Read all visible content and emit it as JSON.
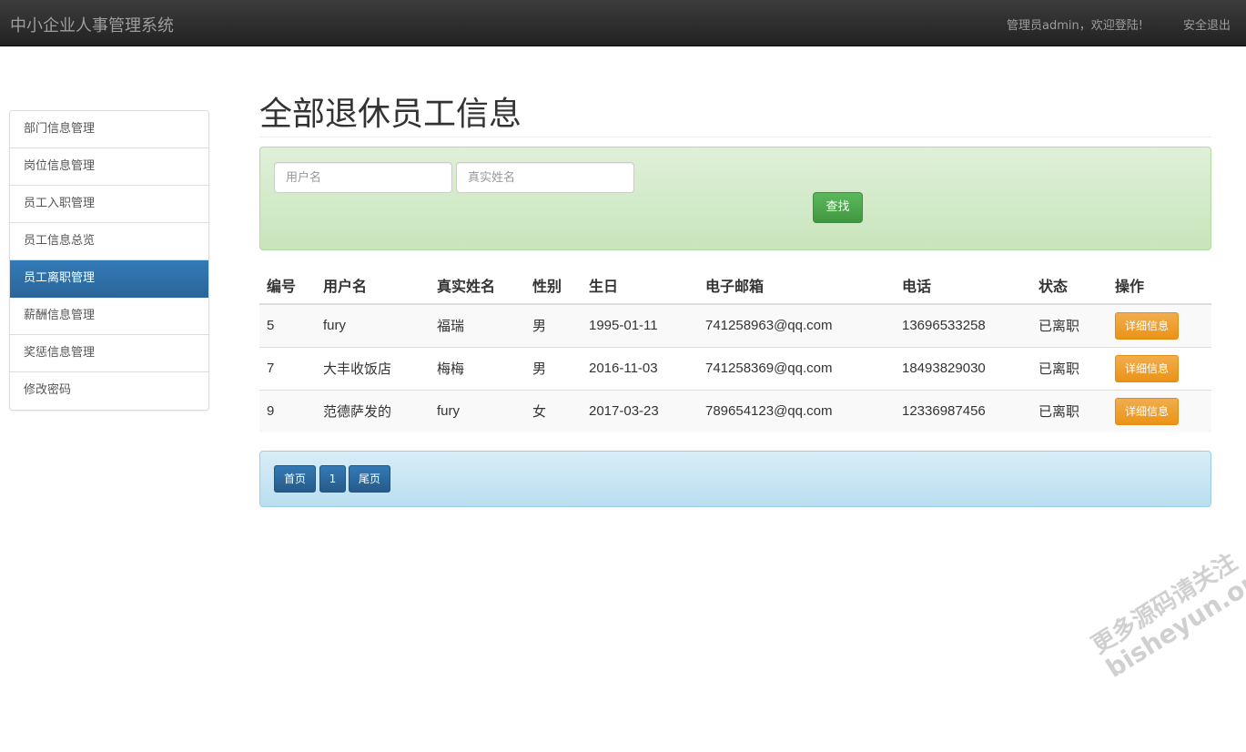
{
  "navbar": {
    "brand": "中小企业人事管理系统",
    "welcome": "管理员admin，欢迎登陆!",
    "logout": "安全退出"
  },
  "sidebar": {
    "items": [
      {
        "label": "部门信息管理"
      },
      {
        "label": "岗位信息管理"
      },
      {
        "label": "员工入职管理"
      },
      {
        "label": "员工信息总览"
      },
      {
        "label": "员工离职管理",
        "active": true
      },
      {
        "label": "薪酬信息管理"
      },
      {
        "label": "奖惩信息管理"
      },
      {
        "label": "修改密码"
      }
    ]
  },
  "main": {
    "title": "全部退休员工信息",
    "search": {
      "username_placeholder": "用户名",
      "realname_placeholder": "真实姓名",
      "button": "查找"
    },
    "table": {
      "headers": [
        "编号",
        "用户名",
        "真实姓名",
        "性别",
        "生日",
        "电子邮箱",
        "电话",
        "状态",
        "操作"
      ],
      "rows": [
        {
          "id": "5",
          "username": "fury",
          "realname": "福瑞",
          "gender": "男",
          "birthday": "1995-01-11",
          "email": "741258963@qq.com",
          "phone": "13696533258",
          "status": "已离职",
          "action": "详细信息"
        },
        {
          "id": "7",
          "username": "大丰收饭店",
          "realname": "梅梅",
          "gender": "男",
          "birthday": "2016-11-03",
          "email": "741258369@qq.com",
          "phone": "18493829030",
          "status": "已离职",
          "action": "详细信息"
        },
        {
          "id": "9",
          "username": "范德萨发的",
          "realname": "fury",
          "gender": "女",
          "birthday": "2017-03-23",
          "email": "789654123@qq.com",
          "phone": "12336987456",
          "status": "已离职",
          "action": "详细信息"
        }
      ]
    },
    "pagination": {
      "first": "首页",
      "current": "1",
      "last": "尾页"
    }
  },
  "watermark": {
    "line1": "更多源码请关注",
    "line2": "bisheyun.org"
  },
  "colors": {
    "navbar": "#222222",
    "active_item": "#337ab7",
    "search_panel": "#dff0d8",
    "search_button": "#5cb85c",
    "detail_button": "#f0ad4e",
    "pager_panel": "#d9edf7"
  }
}
